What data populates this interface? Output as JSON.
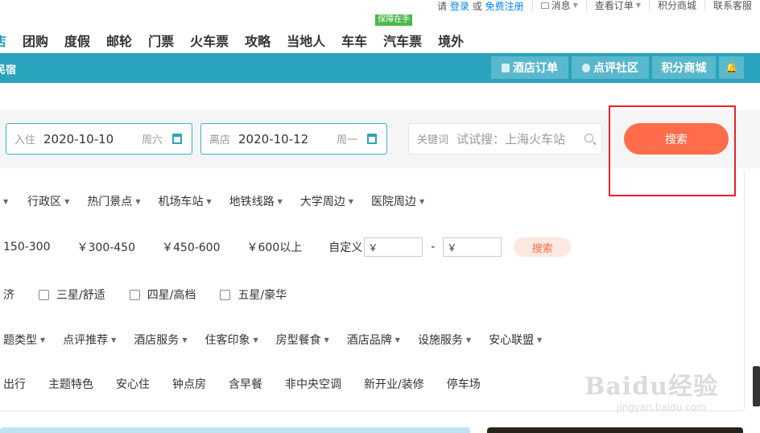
{
  "util": {
    "please": "请",
    "login": "登录",
    "or": "或",
    "register": "免费注册",
    "messages": "消息",
    "orders": "查看订单",
    "points": "积分商城",
    "service": "联系客服"
  },
  "nav": {
    "items": [
      "店",
      "团购",
      "度假",
      "邮轮",
      "门票",
      "火车票",
      "攻略",
      "当地人",
      "车车",
      "汽车票",
      "境外"
    ],
    "badge": "保障在手"
  },
  "subnav": {
    "brand": "民宿",
    "hotel_orders": "酒店订单",
    "reviews": "点评社区",
    "points_mall": "积分商城"
  },
  "search": {
    "checkin_label": "入住",
    "checkin_date": "2020-10-10",
    "checkin_weekday": "周六",
    "checkout_label": "离店",
    "checkout_date": "2020-10-12",
    "checkout_weekday": "周一",
    "keyword_label": "关键词",
    "keyword_placeholder": "试试搜：上海火车站",
    "button": "搜索"
  },
  "filters": {
    "location": [
      "行政区",
      "热门景点",
      "机场车站",
      "地铁线路",
      "大学周边",
      "医院周边"
    ],
    "price": [
      "150-300",
      "￥300-450",
      "￥450-600",
      "￥600以上"
    ],
    "custom_label": "自定义",
    "currency": "￥",
    "dash": "-",
    "price_search": "搜索",
    "star_lead": "济",
    "stars": [
      "三星/舒适",
      "四星/高档",
      "五星/豪华"
    ],
    "more": [
      "题类型",
      "点评推荐",
      "酒店服务",
      "住客印象",
      "房型餐食",
      "酒店品牌",
      "设施服务",
      "安心联盟"
    ],
    "tags": [
      "出行",
      "主题特色",
      "安心住",
      "钟点房",
      "含早餐",
      "非中央空调",
      "新开业/装修",
      "停车场"
    ]
  },
  "watermark": {
    "brand": "Baidu经验",
    "url": "jingyan.baidu.com"
  },
  "colors": {
    "teal": "#2aa3bd",
    "search_orange": "#ff6d4a",
    "highlight_red": "#e8232b"
  }
}
